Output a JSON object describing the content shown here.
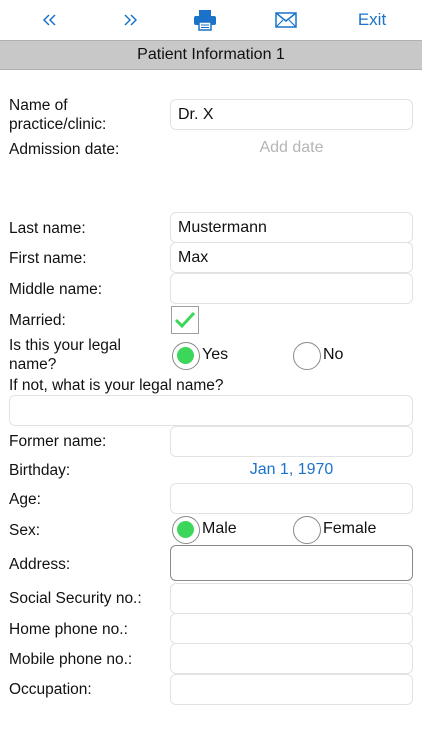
{
  "toolbar": {
    "prev_icon": "double-chevron-left-icon",
    "next_icon": "double-chevron-right-icon",
    "print_icon": "printer-icon",
    "mail_icon": "envelope-icon",
    "exit_label": "Exit",
    "accent_color": "#1a73c9"
  },
  "page_title": "Patient Information 1",
  "form": {
    "practice": {
      "label": "Name of practice/clinic:",
      "value": "Dr. X"
    },
    "admission": {
      "label": "Admission date:",
      "placeholder": "Add date"
    },
    "last_name": {
      "label": "Last name:",
      "value": "Mustermann"
    },
    "first_name": {
      "label": "First name:",
      "value": "Max"
    },
    "middle_name": {
      "label": "Middle name:",
      "value": ""
    },
    "married": {
      "label": "Married:",
      "checked": true
    },
    "legal_name": {
      "label": "Is this your legal name?",
      "options": [
        {
          "label": "Yes",
          "selected": true
        },
        {
          "label": "No",
          "selected": false
        }
      ]
    },
    "legal_name_alt": {
      "label": "If not, what is your legal name?",
      "value": ""
    },
    "former_name": {
      "label": "Former name:",
      "value": ""
    },
    "birthday": {
      "label": "Birthday:",
      "value": "Jan 1, 1970"
    },
    "age": {
      "label": "Age:",
      "value": ""
    },
    "sex": {
      "label": "Sex:",
      "options": [
        {
          "label": "Male",
          "selected": true
        },
        {
          "label": "Female",
          "selected": false
        }
      ]
    },
    "address": {
      "label": "Address:",
      "value": ""
    },
    "ssn": {
      "label": "Social Security no.:",
      "value": ""
    },
    "home_phone": {
      "label": "Home phone no.:",
      "value": ""
    },
    "mobile_phone": {
      "label": "Mobile phone no.:",
      "value": ""
    },
    "occupation": {
      "label": "Occupation:",
      "value": ""
    }
  },
  "colors": {
    "radio_selected": "#3cd75a",
    "check_mark": "#3cd75a",
    "title_bar": "#c8c8c8"
  }
}
